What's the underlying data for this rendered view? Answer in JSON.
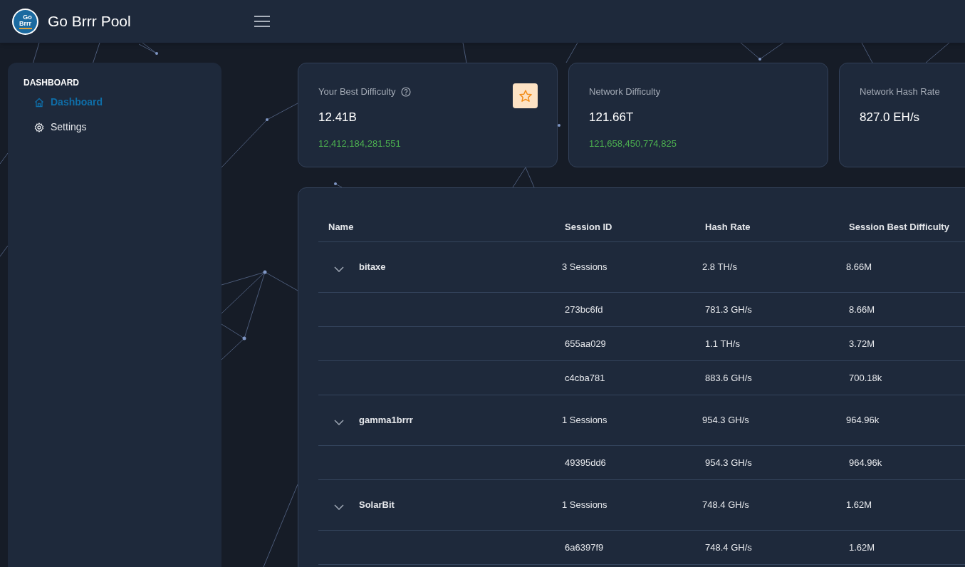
{
  "header": {
    "title": "Go Brrr Pool",
    "logo_text": [
      "Go",
      "Brrr"
    ]
  },
  "sidebar": {
    "section": "DASHBOARD",
    "items": [
      {
        "label": "Dashboard",
        "kind": "home",
        "selected": true
      },
      {
        "label": "Settings",
        "kind": "gear",
        "selected": false
      }
    ]
  },
  "cards": [
    {
      "title": "Your Best Difficulty",
      "value": "12.41B",
      "detail": "12,412,184,281.551",
      "help": true,
      "star": true
    },
    {
      "title": "Network Difficulty",
      "value": "121.66T",
      "detail": "121,658,450,774,825",
      "help": false,
      "star": false
    },
    {
      "title": "Network Hash Rate",
      "value": "827.0 EH/s",
      "help": false,
      "star": false
    }
  ],
  "table": {
    "columns": [
      "Name",
      "Session ID",
      "Hash Rate",
      "Session Best Difficulty"
    ],
    "groups": [
      {
        "name": "bitaxe",
        "expanded": true,
        "sessions_count": "3 Sessions",
        "hash_rate": "2.8 TH/s",
        "best_difficulty": "8.66M",
        "sessions": [
          {
            "id": "273bc6fd",
            "hash_rate": "781.3 GH/s",
            "best_difficulty": "8.66M"
          },
          {
            "id": "655aa029",
            "hash_rate": "1.1 TH/s",
            "best_difficulty": "3.72M"
          },
          {
            "id": "c4cba781",
            "hash_rate": "883.6 GH/s",
            "best_difficulty": "700.18k"
          }
        ]
      },
      {
        "name": "gamma1brrr",
        "expanded": true,
        "sessions_count": "1 Sessions",
        "hash_rate": "954.3 GH/s",
        "best_difficulty": "964.96k",
        "sessions": [
          {
            "id": "49395dd6",
            "hash_rate": "954.3 GH/s",
            "best_difficulty": "964.96k"
          }
        ]
      },
      {
        "name": "SolarBit",
        "expanded": true,
        "sessions_count": "1 Sessions",
        "hash_rate": "748.4 GH/s",
        "best_difficulty": "1.62M",
        "sessions": [
          {
            "id": "6a6397f9",
            "hash_rate": "748.4 GH/s",
            "best_difficulty": "1.62M"
          }
        ]
      }
    ]
  }
}
